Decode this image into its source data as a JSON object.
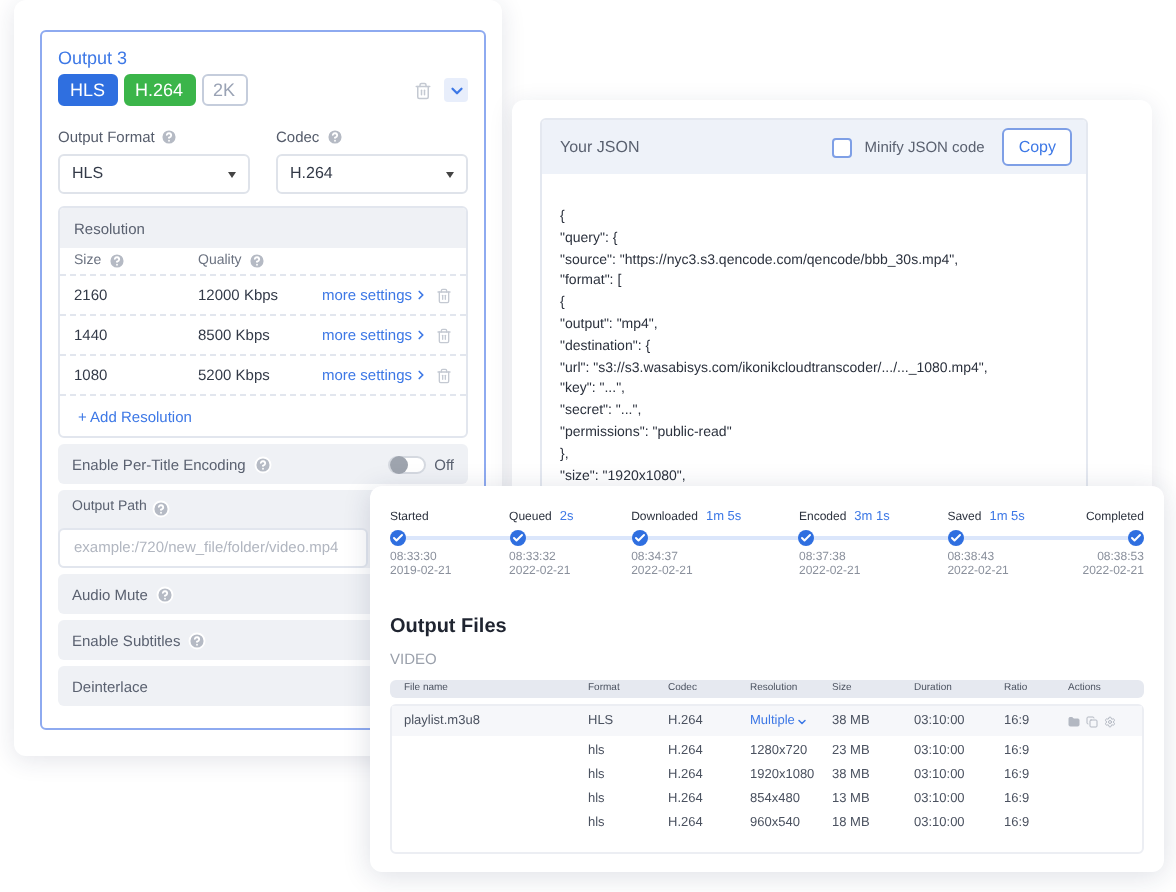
{
  "output_panel": {
    "title": "Output 3",
    "tags": [
      {
        "label": "HLS",
        "kind": "blue"
      },
      {
        "label": "H.264",
        "kind": "green"
      },
      {
        "label": "2K",
        "kind": "outline"
      }
    ],
    "expanded": true,
    "fields": [
      {
        "label": "Output Format",
        "value": "HLS"
      },
      {
        "label": "Codec",
        "value": "H.264"
      }
    ],
    "resolution": {
      "title": "Resolution",
      "columns": [
        "Size",
        "Quality"
      ],
      "rows": [
        {
          "size": "2160",
          "quality": "12000 Kbps",
          "link": "more settings"
        },
        {
          "size": "1440",
          "quality": "8500 Kbps",
          "link": "more settings"
        },
        {
          "size": "1080",
          "quality": "5200 Kbps",
          "link": "more settings"
        }
      ],
      "add": "+ Add Resolution"
    },
    "per_title": {
      "label": "Enable Per-Title Encoding",
      "on": false,
      "state_label": "Off"
    },
    "output_path": {
      "label": "Output Path",
      "placeholder": "example:/720/new_file/folder/video.mp4"
    },
    "options": [
      "Audio Mute",
      "Enable Subtitles",
      "Deinterlace"
    ]
  },
  "json_panel": {
    "title": "Your JSON",
    "minify": {
      "label": "Minify JSON code",
      "checked": false
    },
    "copy": "Copy",
    "lines": [
      "{",
      "\"query\": {",
      "\"source\": \"https://nyc3.s3.qencode.com/qencode/bbb_30s.mp4\",",
      "\"format\": [",
      "{",
      "\"output\": \"mp4\",",
      "\"destination\": {",
      "\"url\": \"s3://s3.wasabisys.com/ikonikcloudtranscoder/.../..._1080.mp4\",",
      "\"key\": \"...\",",
      "\"secret\": \"...\",",
      "\"permissions\": \"public-read\"",
      "},",
      "\"size\": \"1920x1080\","
    ]
  },
  "job_panel": {
    "steps": [
      {
        "label": "Started",
        "time": "08:33:30",
        "date": "2019-02-21",
        "done": true
      },
      {
        "label": "Queued",
        "duration": "2s",
        "time": "08:33:32",
        "date": "2022-02-21",
        "done": true
      },
      {
        "label": "Downloaded",
        "duration": "1m 5s",
        "time": "08:34:37",
        "date": "2022-02-21",
        "done": true
      },
      {
        "label": "Encoded",
        "duration": "3m 1s",
        "time": "08:37:38",
        "date": "2022-02-21",
        "done": true
      },
      {
        "label": "Saved",
        "duration": "1m 5s",
        "time": "08:38:43",
        "date": "2022-02-21",
        "done": true
      },
      {
        "label": "Completed",
        "time": "08:38:53",
        "date": "2022-02-21",
        "done": true
      }
    ],
    "title": "Output Files",
    "section": "VIDEO",
    "table": {
      "columns": [
        "File name",
        "Format",
        "Codec",
        "Resolution",
        "Size",
        "Duration",
        "Ratio",
        "Actions"
      ],
      "main_row": {
        "file": "playlist.m3u8",
        "format": "HLS",
        "codec": "H.264",
        "resolution": "Multiple",
        "expanded": true,
        "size": "38 MB",
        "duration": "03:10:00",
        "ratio": "16:9"
      },
      "sub_rows": [
        {
          "format": "hls",
          "codec": "H.264",
          "resolution": "1280x720",
          "size": "23 MB",
          "duration": "03:10:00",
          "ratio": "16:9"
        },
        {
          "format": "hls",
          "codec": "H.264",
          "resolution": "1920x1080",
          "size": "38 MB",
          "duration": "03:10:00",
          "ratio": "16:9"
        },
        {
          "format": "hls",
          "codec": "H.264",
          "resolution": "854x480",
          "size": "13 MB",
          "duration": "03:10:00",
          "ratio": "16:9"
        },
        {
          "format": "hls",
          "codec": "H.264",
          "resolution": "960x540",
          "size": "18 MB",
          "duration": "03:10:00",
          "ratio": "16:9"
        }
      ]
    }
  }
}
